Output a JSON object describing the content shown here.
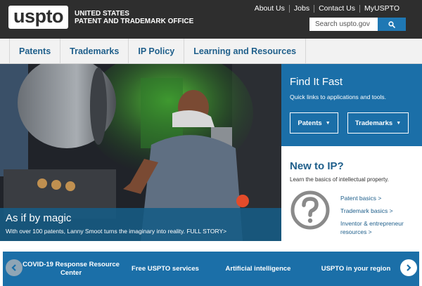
{
  "header": {
    "logo_text": "uspto",
    "agency_line1": "UNITED STATES",
    "agency_line2": "PATENT AND TRADEMARK OFFICE",
    "top_links": [
      "About Us",
      "Jobs",
      "Contact Us",
      "MyUSPTO"
    ],
    "search_placeholder": "Search uspto.gov",
    "search_icon": "search-icon"
  },
  "nav": {
    "items": [
      "Patents",
      "Trademarks",
      "IP Policy",
      "Learning and Resources"
    ]
  },
  "hero": {
    "title": "As if by magic",
    "text": "With over 100 patents, Lanny Smoot turns the imaginary into reality. FULL STORY>"
  },
  "find_it_fast": {
    "title": "Find It Fast",
    "subtitle": "Quick links to applications and tools.",
    "buttons": [
      "Patents",
      "Trademarks"
    ]
  },
  "new_to_ip": {
    "title": "New to IP?",
    "subtitle": "Learn the basics of intellectual property.",
    "icon": "question-circle-icon",
    "links": [
      "Patent basics >",
      "Trademark basics >",
      "Inventor & entrepreneur",
      "resources >"
    ]
  },
  "carousel": {
    "items": [
      {
        "line1": "COVID-19 Response Resource",
        "line2": "Center"
      },
      {
        "line1": "Free USPTO services",
        "line2": ""
      },
      {
        "line1": "Artificial intelligence",
        "line2": ""
      },
      {
        "line1": "USPTO in your region",
        "line2": ""
      }
    ],
    "prev_icon": "chevron-left-icon",
    "next_icon": "chevron-right-icon"
  },
  "colors": {
    "header_bg": "#2e2e2e",
    "brand_blue": "#1b6fa8",
    "link_blue": "#1f5f8b",
    "nav_bg": "#f2f2f2"
  }
}
